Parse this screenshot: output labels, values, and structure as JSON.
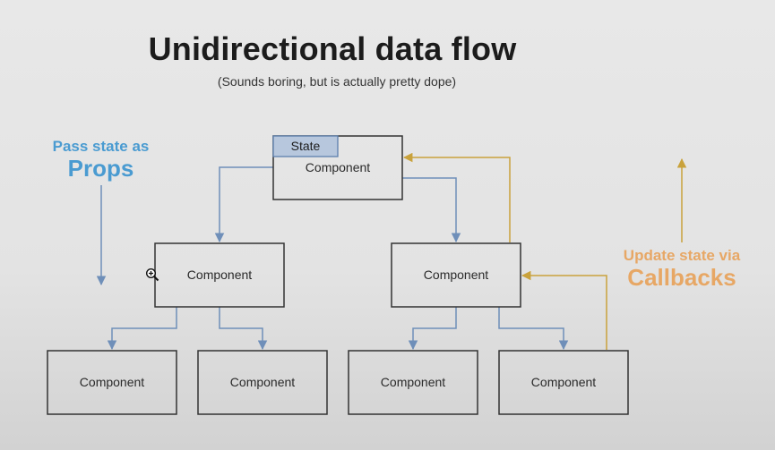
{
  "slide": {
    "title": "Unidirectional data flow",
    "subtitle": "(Sounds boring, but is actually pretty dope)"
  },
  "left_annotation": {
    "line1": "Pass state as",
    "line2": "Props",
    "color": "#4a9bd1"
  },
  "right_annotation": {
    "line1": "Update state via",
    "line2": "Callbacks",
    "color": "#e7a765"
  },
  "diagram": {
    "state_tag": "State",
    "nodes": [
      {
        "id": "root",
        "label": "Component",
        "has_state": true
      },
      {
        "id": "mid-left",
        "label": "Component",
        "parent": "root"
      },
      {
        "id": "mid-right",
        "label": "Component",
        "parent": "root"
      },
      {
        "id": "leaf-1",
        "label": "Component",
        "parent": "mid-left"
      },
      {
        "id": "leaf-2",
        "label": "Component",
        "parent": "mid-left"
      },
      {
        "id": "leaf-3",
        "label": "Component",
        "parent": "mid-right"
      },
      {
        "id": "leaf-4",
        "label": "Component",
        "parent": "mid-right"
      }
    ],
    "colors": {
      "props_flow": "#6f8fb9",
      "callback_flow": "#c9a23c"
    }
  },
  "cursor": {
    "icon": "zoom-in-cursor-icon"
  }
}
